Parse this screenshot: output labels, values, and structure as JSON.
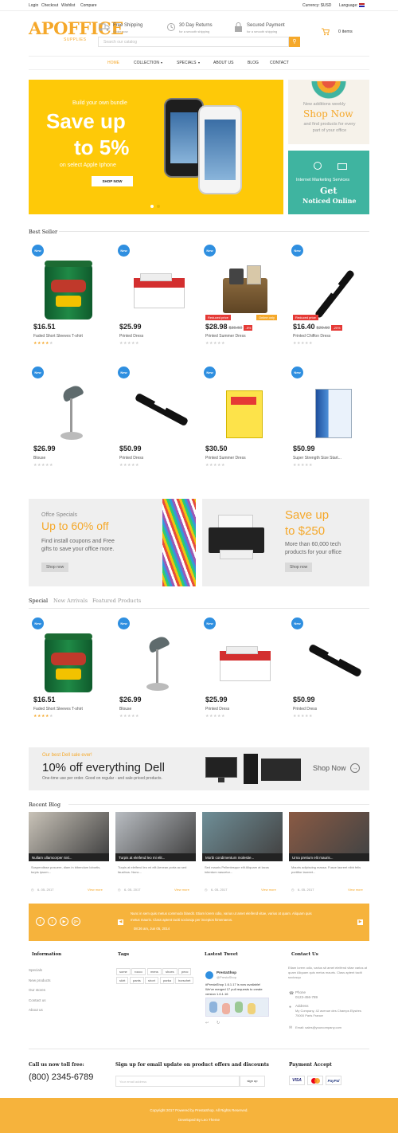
{
  "topbar": {
    "links": [
      "Login",
      "Checkout",
      "Wishlist",
      "Compare"
    ],
    "currency": "Currency: $USD",
    "language": "Language:"
  },
  "header": {
    "logo": "APOFFICE",
    "logo_sub": "SUPPLIES",
    "features": [
      {
        "title": "Free Shipping",
        "sub": "Order now"
      },
      {
        "title": "30 Day Returns",
        "sub": "for a smooth shipping"
      },
      {
        "title": "Secured Payment",
        "sub": "for a smooth shipping"
      }
    ],
    "search_placeholder": "Search our catalog",
    "cart": "0 items"
  },
  "nav": [
    "Home",
    "Collection",
    "Specials",
    "About Us",
    "Blog",
    "Contact"
  ],
  "hero": {
    "line1": "Build your own bundle",
    "line2": "Save up",
    "line3": "to 5%",
    "line4": "on select Apple Iphone",
    "button": "SHOP NOW"
  },
  "side_banners": [
    {
      "small": "New additions weekly",
      "big": "Shop Now",
      "desc": "and find products for every part of your office"
    },
    {
      "small": "Internet Marketing Services",
      "big1": "Get",
      "big2": "Noticed Online"
    }
  ],
  "best_seller": {
    "title": "Best Seller",
    "new_label": "New",
    "reduced_label": "Reduced price",
    "online_label": "Online only",
    "products": [
      {
        "price": "$16.51",
        "name": "Faded Short Sleeves T-shirt",
        "stars": 4
      },
      {
        "price": "$25.99",
        "name": "Printed Dress",
        "stars": 0
      },
      {
        "price": "$28.98",
        "old": "$30.50",
        "disc": "-5%",
        "name": "Printed Summer Dress",
        "stars": 0
      },
      {
        "price": "$16.40",
        "old": "$20.50",
        "disc": "-20%",
        "name": "Printed Chiffon Dress",
        "stars": 0
      },
      {
        "price": "$26.99",
        "name": "Blouse",
        "stars": 0
      },
      {
        "price": "$50.99",
        "name": "Printed Dress",
        "stars": 0
      },
      {
        "price": "$30.50",
        "name": "Printed Summer Dress",
        "stars": 0
      },
      {
        "price": "$50.99",
        "name": "Super Strength Size Start...",
        "stars": 0
      }
    ]
  },
  "promos": [
    {
      "small": "Offce Specials",
      "big": "Up to 60% off",
      "desc1": "Find install coupons and Free",
      "desc2": "gifts to save your office more.",
      "button": "Shop now"
    },
    {
      "big1": "Save up",
      "big2": "to $250",
      "desc1": "More than 60,000 tech",
      "desc2": "products for your office",
      "button": "Shop now"
    }
  ],
  "tabs": {
    "items": [
      "Special",
      "New Arrivals",
      "Featured Products"
    ],
    "products": [
      {
        "price": "$16.51",
        "name": "Faded Short Sleeves T-shirt",
        "stars": 4
      },
      {
        "price": "$26.99",
        "name": "Blouse",
        "stars": 0
      },
      {
        "price": "$25.99",
        "name": "Printed Dress",
        "stars": 0
      },
      {
        "price": "$50.99",
        "name": "Printed Dress",
        "stars": 0
      }
    ]
  },
  "dell": {
    "small": "Our best Dell sale ever!",
    "big": "10% off everything Dell",
    "desc": "One-time use per order. Good on regular - and sale-priced products.",
    "button": "Shop Now"
  },
  "blog": {
    "title": "Recent Blog",
    "posts": [
      {
        "caption": "Nullam ullamcorper nisl...",
        "text": "Suspendisse posuere, diam in bibendum lobortis, turpis ipsum...",
        "date": "6- 05- 2017",
        "more": "View more",
        "color": "#c9c3b8"
      },
      {
        "caption": "Turpis at eleifend leo mi elit...",
        "text": "Turpis at eleifend leo mi elit Aenean porta ac sed faucibus. Nunc...",
        "date": "6- 05- 2017",
        "more": "View more",
        "color": "#b9bdc2"
      },
      {
        "caption": "Morbi condimentum molestie...",
        "text": "Sed mauris Pellentesque elit Aliquam at lacus interdum nascetur...",
        "date": "6- 05- 2017",
        "more": "View more",
        "color": "#6f8f98"
      },
      {
        "caption": "Urna pretium elit mauris...",
        "text": "Mauris adipiscing massa. Fusce laoreet nibh felis porttitor laoreet...",
        "date": "6- 05- 2017",
        "more": "View more",
        "color": "#8a5a44"
      }
    ]
  },
  "tweet_bar": {
    "text1": "Nunc in sem quis metus commodo blandit. Etiam lorem odio, varius ut amet eleifend vitae, varius at quam. Aliquam quis",
    "text2": "metus mauris. Class aptent taciti sociosqu per inceptos himenaeos.",
    "time": "08:36 am, Jun 05, 2014"
  },
  "footer": {
    "information": {
      "title": "Information",
      "links": [
        "Specials",
        "New products",
        "Our stores",
        "Contact us",
        "About us"
      ]
    },
    "tags": {
      "title": "Tags",
      "items": [
        "some",
        "rocco",
        "mens",
        "shoes",
        "pecc",
        "skirt",
        "pants",
        "short",
        "parka",
        "horschet"
      ]
    },
    "tweet": {
      "title": "Lastest Tweet",
      "user": "PrestaShop",
      "handle": "@PrestaShop",
      "text1": "#PrestaShop 1.6.1.17 is now available!",
      "text2": "We've merged 17 pull requests to create",
      "text3": "version 1.6.1.16"
    },
    "contact": {
      "title": "Contact Us",
      "desc": "Etiam lorem odio, varius sit amet eleifend vitae varius at quam Aliquam quis metus mauris. Class aptent taciti sociosqu",
      "phone_label": "Phone",
      "phone": "0123-456-789",
      "address_label": "Address",
      "address": "My Company, 42 avenue des Champs Elysées 75000 Paris France",
      "email": "Email: sales@yourcompany.com"
    }
  },
  "subfooter": {
    "call_label": "Call us now toll free:",
    "phone": "(800) 2345-6789",
    "signup": "Sign up for email update on product offers and discounts",
    "email_placeholder": "Your email address",
    "signup_button": "sign up",
    "payment": "Payment Accept",
    "cards": [
      "VISA",
      "",
      "PayPal"
    ]
  },
  "bottom": {
    "copy": "Copyright 2017 Powered by PrestaShop. All Rights Reserved.",
    "dev": "Developed By Leo Theme"
  },
  "colors": {
    "accent": "#f5a82a",
    "hero": "#fec908",
    "teal": "#3fb4a0",
    "badge": "#2f8fe0",
    "sale": "#e53935"
  }
}
